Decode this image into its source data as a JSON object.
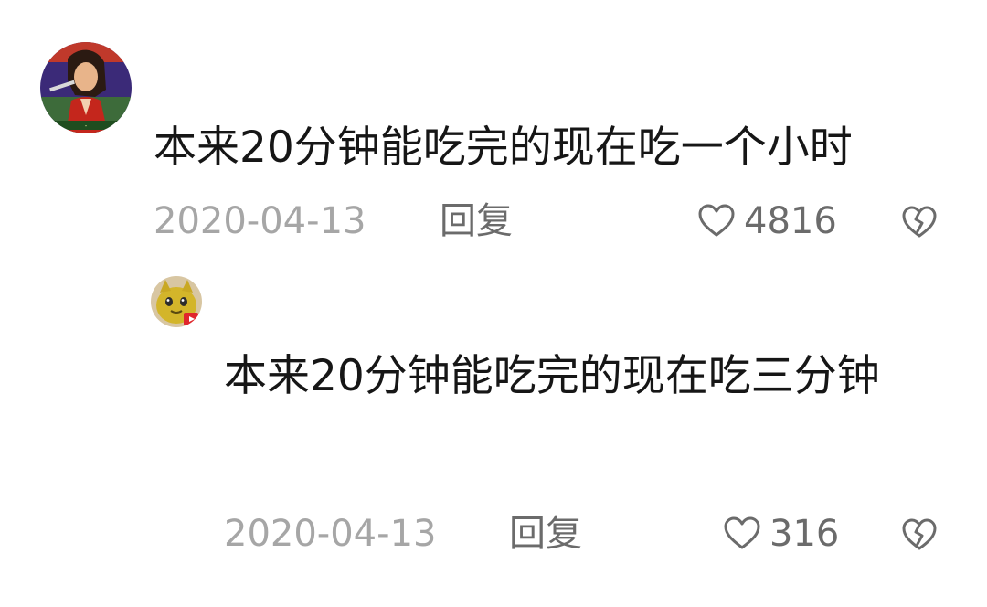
{
  "comments": [
    {
      "avatar_icon": "fighter-avatar",
      "text": "本来20分钟能吃完的现在吃一个小时",
      "date": "2020-04-13",
      "reply_label": "回复",
      "like_icon": "heart-outline-icon",
      "likes": "4816",
      "dislike_icon": "broken-heart-icon"
    },
    {
      "avatar_icon": "yellow-character-avatar",
      "text": "本来20分钟能吃完的现在吃三分钟",
      "date": "2020-04-13",
      "reply_label": "回复",
      "like_icon": "heart-outline-icon",
      "likes": "316",
      "dislike_icon": "broken-heart-icon"
    }
  ],
  "colors": {
    "text": "#161616",
    "meta": "#a6a6a6",
    "action": "#6b6b6b"
  }
}
